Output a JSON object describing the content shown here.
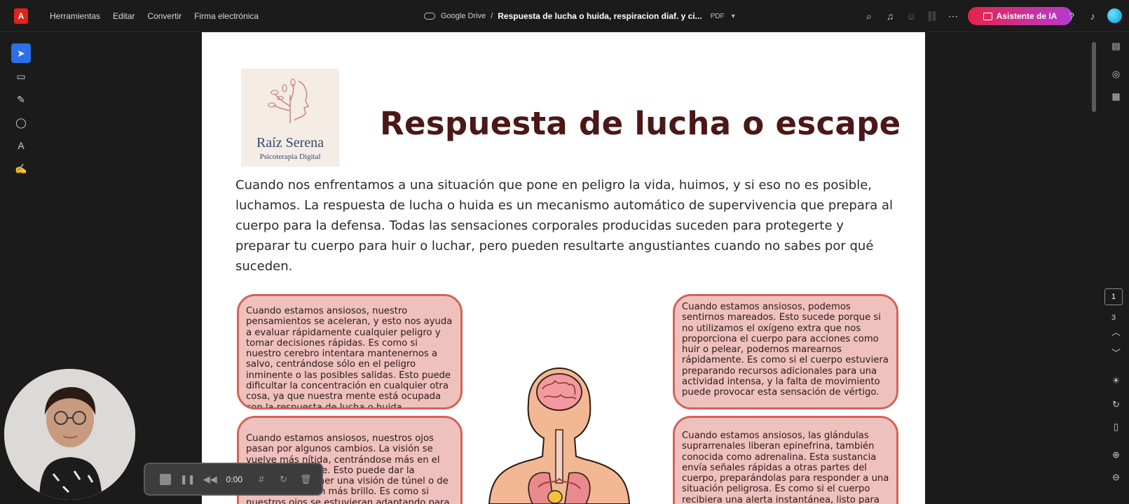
{
  "topbar": {
    "logo": "A",
    "menu": [
      "Herramientas",
      "Editar",
      "Convertir",
      "Firma electrónica"
    ],
    "breadcrumb": {
      "location": "Google Drive",
      "separator": "/",
      "document": "Respuesta de lucha o huida, respiracion diaf. y ci...",
      "format": "PDF"
    },
    "ai_button": "Asistente de IA"
  },
  "document": {
    "brand_name": "Raíz Serena",
    "brand_sub": "Psicoterapia Digital",
    "title": "Respuesta de lucha o escape",
    "intro": "Cuando nos enfrentamos a una situación  que pone en peligro la vida, huimos, y si eso no es posible, luchamos. La respuesta de lucha o huida es un mecanismo automático de supervivencia que prepara al cuerpo para la defensa. Todas las sensaciones corporales producidas suceden para protegerte y preparar tu cuerpo para huir o luchar, pero pueden resultarte angustiantes cuando no sabes por qué suceden.",
    "cards": [
      "Cuando estamos ansiosos, nuestro pensamientos se aceleran, y esto nos ayuda a evaluar rápidamente cualquier peligro y tomar decisiones rápidas. Es como si nuestro cerebro intentara mantenernos a salvo, centrándose sólo en el peligro inminente o las posibles salidas. Esto puede dificultar la concentración en cualquier otra cosa, ya que nuestra mente está ocupada con la respuesta de lucha o huida.",
      "Cuando estamos ansiosos, podemos sentirnos mareados. Esto sucede porque si no utilizamos el oxígeno extra que nos proporciona el cuerpo para acciones como huir o pelear, podemos marearnos rápidamente. Es como si el cuerpo estuviera preparando recursos adicionales para una actividad intensa, y la falta de movimiento puede provocar esta sensación de vértigo.",
      "Cuando estamos ansiosos, nuestros ojos pasan por algunos cambios. La visión se vuelve más nítida, centrándose más en el peligro inminente. Esto puede dar la sensación de tener una visión de túnel o de ver las cosas con más brillo. Es como si nuestros ojos se estuvieran adaptando para prestar más atención a lo que podría representar una amenaza.",
      "Cuando estamos ansiosos, las glándulas suprarrenales liberan epinefrina, también conocida como adrenalina. Esta sustancia envía señales rápidas a otras partes del cuerpo, preparándolas para responder a una situación peligrosa. Es como si el cuerpo recibiera una alerta instantánea, listo para actuar ante cualquier desafío inminente."
    ]
  },
  "navigation": {
    "current_page": "1",
    "total_pages": "3"
  },
  "recorder": {
    "time": "0:00"
  }
}
